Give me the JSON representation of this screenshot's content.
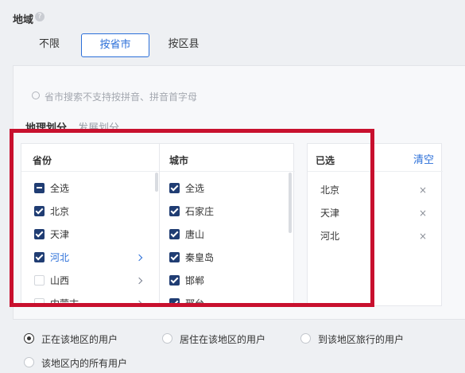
{
  "region": {
    "title": "地域",
    "help_icon": "question-circle-icon",
    "options": [
      "不限",
      "按省市",
      "按区县"
    ],
    "selected_option": "按省市"
  },
  "search": {
    "placeholder": "省市搜索不支持按拼音、拼音首字母"
  },
  "tabs": [
    "地理划分",
    "发展划分"
  ],
  "province": {
    "header": "省份",
    "items": [
      {
        "label": "全选",
        "state": "indeterminate"
      },
      {
        "label": "北京",
        "state": "checked"
      },
      {
        "label": "天津",
        "state": "checked"
      },
      {
        "label": "河北",
        "state": "checked",
        "highlight": true
      },
      {
        "label": "山西",
        "state": "unchecked"
      },
      {
        "label": "内蒙古",
        "state": "unchecked"
      }
    ]
  },
  "city": {
    "header": "城市",
    "items": [
      {
        "label": "全选",
        "state": "checked"
      },
      {
        "label": "石家庄",
        "state": "checked"
      },
      {
        "label": "唐山",
        "state": "checked"
      },
      {
        "label": "秦皇岛",
        "state": "checked"
      },
      {
        "label": "邯郸",
        "state": "checked"
      },
      {
        "label": "邢台",
        "state": "checked"
      }
    ]
  },
  "selected": {
    "header": "已选",
    "clear_label": "清空",
    "items": [
      "北京",
      "天津",
      "河北"
    ],
    "remove_symbol": "×"
  },
  "user_scope": {
    "options": [
      "正在该地区的用户",
      "居住在该地区的用户",
      "到该地区旅行的用户",
      "该地区内的所有用户"
    ],
    "selected": "正在该地区的用户"
  },
  "colors": {
    "accent": "#2b6fd9",
    "checkbox": "#203d73",
    "highlight_box": "#c8102e"
  }
}
